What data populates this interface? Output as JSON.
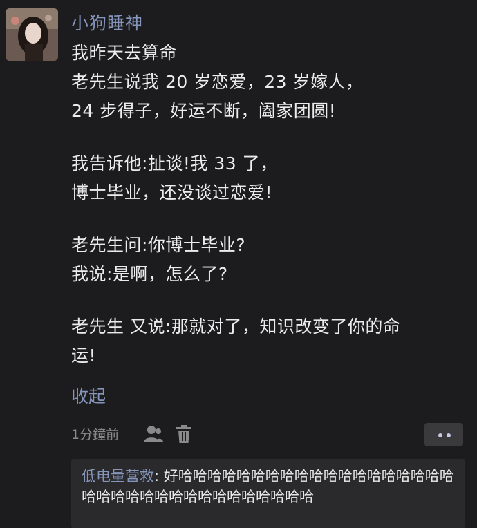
{
  "post": {
    "username": "小狗睡神",
    "paragraphs": [
      [
        "我昨天去算命",
        "老先生说我 20 岁恋爱，23 岁嫁人，",
        "24 步得子，好运不断，阖家团圆!"
      ],
      [
        "我告诉他:扯谈!我 33 了，",
        "博士毕业，还没谈过恋爱!"
      ],
      [
        "老先生问:你博士毕业?",
        "我说:是啊，怎么了?"
      ],
      [
        "老先生 又说:那就对了，知识改变了你的命",
        "运!"
      ]
    ],
    "collapse_label": "收起",
    "timestamp": "1分鐘前"
  },
  "icons": {
    "user": "user-icon",
    "trash": "trash-icon",
    "more": "more-dots-icon"
  },
  "comment": {
    "author": "低电量营救",
    "separator": ": ",
    "text": "好哈哈哈哈哈哈哈哈哈哈哈哈哈哈哈哈哈哈哈哈哈哈哈哈哈哈哈哈哈哈哈哈哈哈哈"
  },
  "colors": {
    "background": "#1c1c1e",
    "link_blue": "#8595bb",
    "text": "#ececec",
    "comment_bg": "#2a2a2c"
  }
}
